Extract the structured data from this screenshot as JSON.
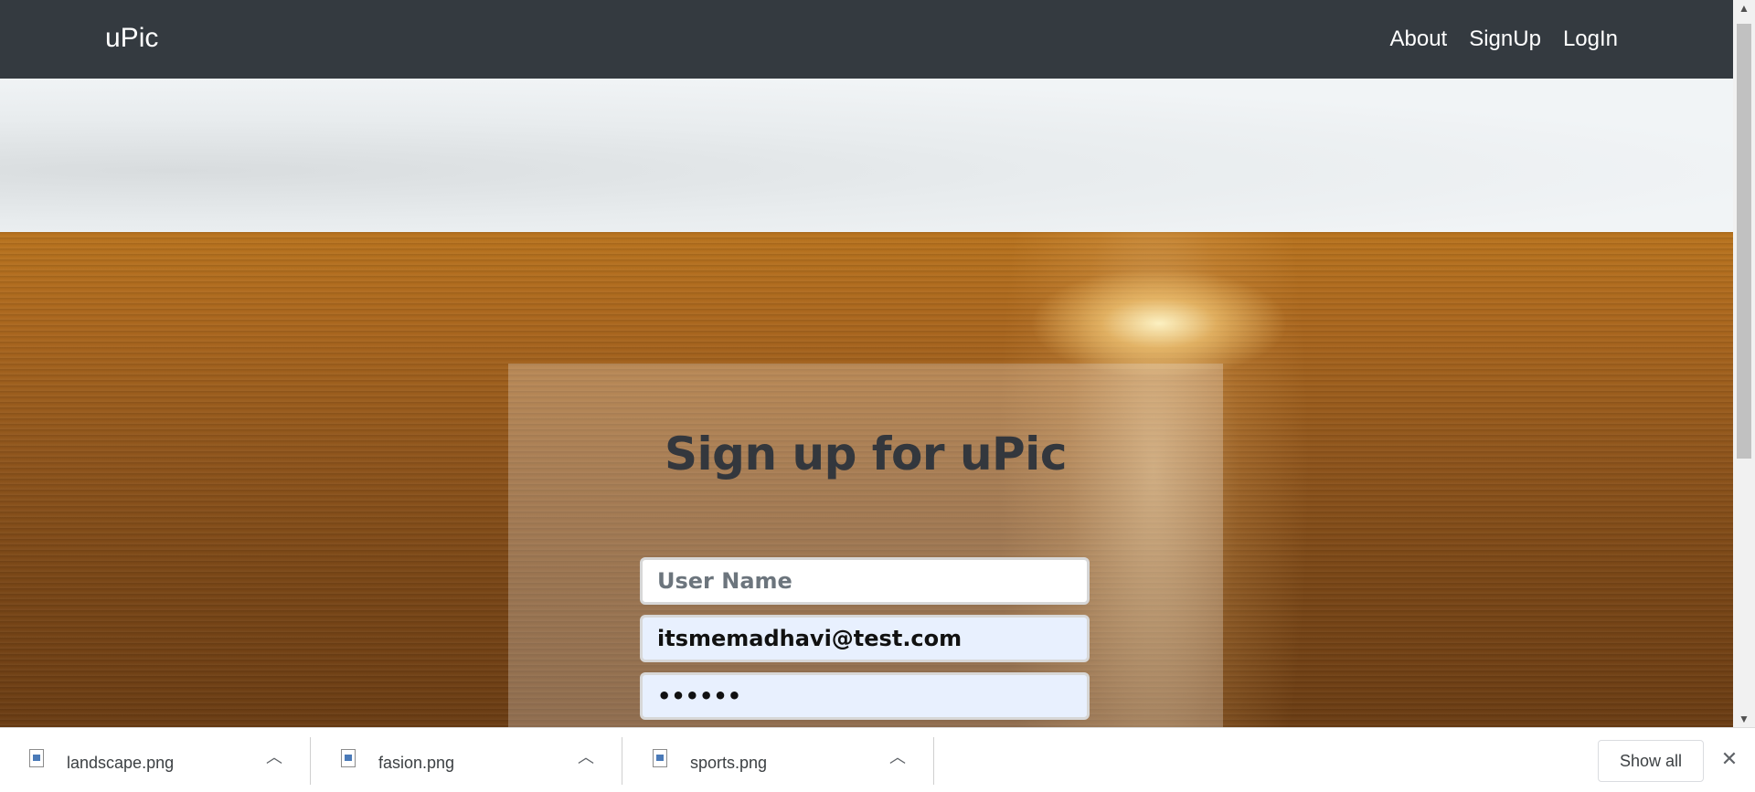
{
  "navbar": {
    "brand": "uPic",
    "links": [
      "About",
      "SignUp",
      "LogIn"
    ]
  },
  "signup": {
    "title": "Sign up for uPic",
    "username_placeholder": "User Name",
    "username_value": "",
    "email_value": "itsmemadhavi@test.com",
    "password_value": "••••••"
  },
  "downloads": {
    "items": [
      {
        "name": "landscape.png",
        "icon": "image-file-icon"
      },
      {
        "name": "fasion.png",
        "icon": "image-file-icon"
      },
      {
        "name": "sports.png",
        "icon": "image-file-icon"
      }
    ],
    "show_all": "Show all",
    "close_glyph": "✕"
  },
  "colors": {
    "navbar": "#343a40",
    "autofill": "#e8f0fe"
  }
}
